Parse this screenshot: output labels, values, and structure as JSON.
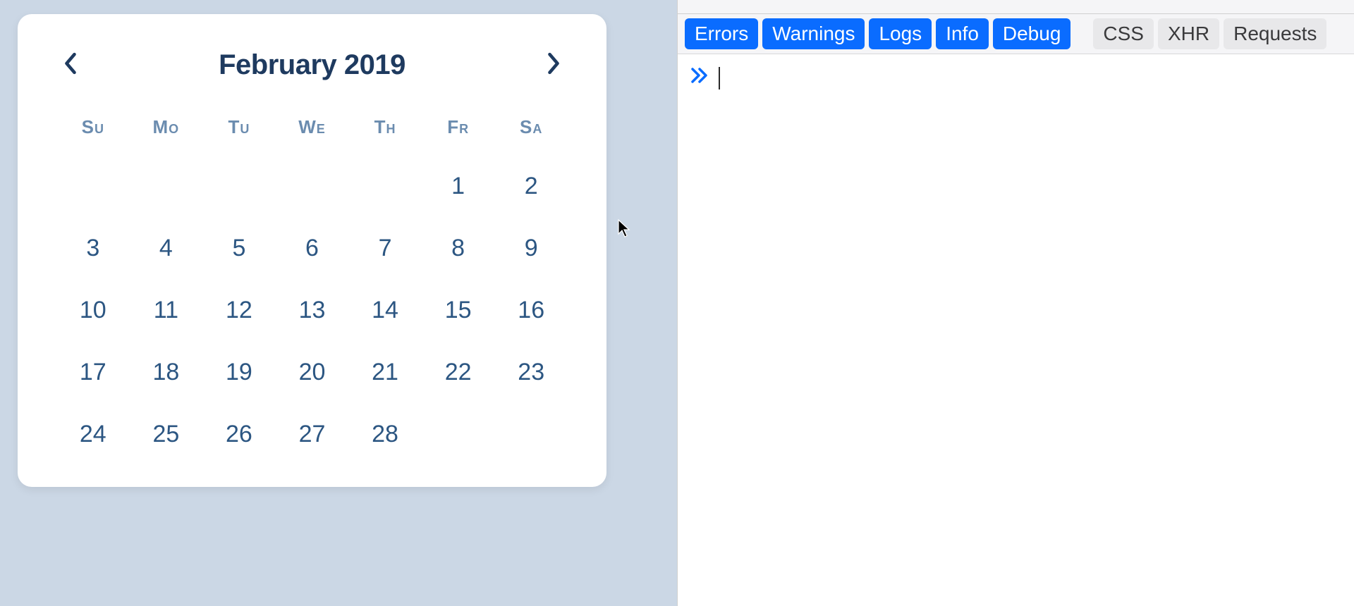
{
  "calendar": {
    "month_title": "February 2019",
    "day_headers": [
      "Su",
      "Mo",
      "Tu",
      "We",
      "Th",
      "Fr",
      "Sa"
    ],
    "weeks": [
      [
        "",
        "",
        "",
        "",
        "",
        "1",
        "2"
      ],
      [
        "3",
        "4",
        "5",
        "6",
        "7",
        "8",
        "9"
      ],
      [
        "10",
        "11",
        "12",
        "13",
        "14",
        "15",
        "16"
      ],
      [
        "17",
        "18",
        "19",
        "20",
        "21",
        "22",
        "23"
      ],
      [
        "24",
        "25",
        "26",
        "27",
        "28",
        "",
        ""
      ]
    ]
  },
  "devtools": {
    "filters_active": [
      "Errors",
      "Warnings",
      "Logs",
      "Info",
      "Debug"
    ],
    "filters_inactive": [
      "CSS",
      "XHR",
      "Requests"
    ]
  }
}
